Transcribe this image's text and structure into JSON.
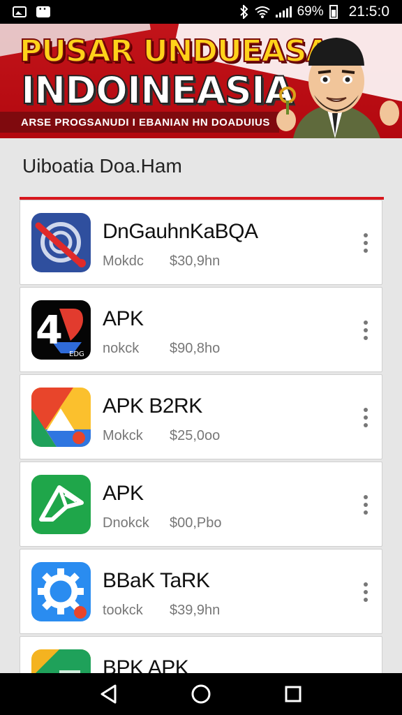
{
  "status_bar": {
    "indicators": "ℵ ⚞ .ıl 69%",
    "time": "21:5:0",
    "icons": [
      "image-icon",
      "message-icon",
      "bluetooth-icon",
      "wifi-icon",
      "signal-icon",
      "battery-icon"
    ]
  },
  "banner": {
    "title_line1": "PUSAR UNDUEASA",
    "title_line2": "INDOINEASIA",
    "subtitle": "ARSE PROGSANUDI I EBANIAN HN DOADUIUS",
    "colors": {
      "red": "#c2141a",
      "yellow": "#ffd21a"
    }
  },
  "section": {
    "title": "Uiboatia Doa.Ham"
  },
  "apps": [
    {
      "name": "DnGauhnKaBQA",
      "size": "Mokdc",
      "size_prefix": "ꟻ",
      "price": "$30,9hn",
      "icon": "satellite-app-icon"
    },
    {
      "name": "APK",
      "size": "nokck",
      "size_prefix": "ᚠ",
      "price": "$90,8ho",
      "icon": "4g-app-icon"
    },
    {
      "name": "APK B2RK",
      "size": "Mokck",
      "size_prefix": "ꟻ",
      "price": "$25,0oo",
      "icon": "drive-app-icon"
    },
    {
      "name": "APK",
      "size": "Dnokck",
      "size_prefix": "",
      "price": "$00,Pbo",
      "icon": "green-bird-app-icon"
    },
    {
      "name": "BBaK TaRK",
      "size": "tookck",
      "size_prefix": "",
      "price": "$39,9hn",
      "icon": "gear-app-icon"
    },
    {
      "name": "BPK APK",
      "size": "",
      "size_prefix": "",
      "price": "",
      "icon": "yellow-app-icon"
    }
  ],
  "navbar": {
    "icons": [
      "back-icon",
      "home-icon",
      "recents-icon"
    ]
  }
}
